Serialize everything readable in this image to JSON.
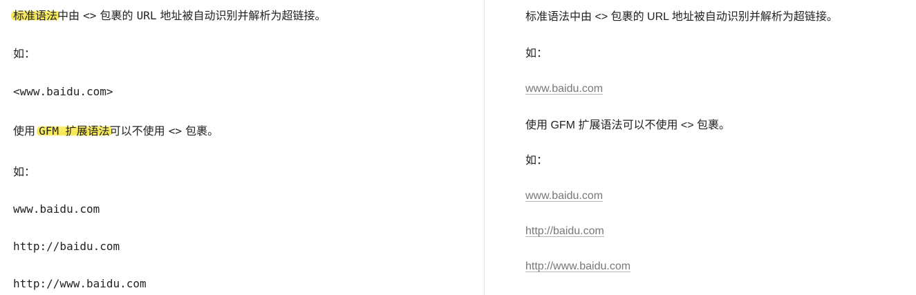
{
  "source_pane": {
    "intro": {
      "highlight": "标准语法",
      "text_1": "中由 ",
      "angle": "<>",
      "text_2": " 包裹的 ",
      "url": "URL",
      "text_3": " 地址被自动识别并解析为超链接。"
    },
    "example_label_1": "如：",
    "angle_example": "<www.baidu.com>",
    "gfm_sentence": {
      "prefix": "使用 ",
      "highlight": "GFM 扩展语法",
      "middle": "可以不使用 ",
      "angle": "<>",
      "suffix": " 包裹。"
    },
    "example_label_2": "如：",
    "urls": [
      "www.baidu.com",
      "http://baidu.com",
      "http://www.baidu.com"
    ]
  },
  "preview_pane": {
    "intro": "标准语法中由 <> 包裹的 URL 地址被自动识别并解析为超链接。",
    "example_label_1": "如：",
    "link_1": "www.baidu.com",
    "gfm_sentence": "使用 GFM 扩展语法可以不使用 <> 包裹。",
    "example_label_2": "如：",
    "links": [
      "www.baidu.com",
      "http://baidu.com",
      "http://www.baidu.com"
    ]
  },
  "colors": {
    "highlight": "#f6e74f",
    "text": "#222222",
    "link": "#777777",
    "divider": "#e6e6e6"
  }
}
